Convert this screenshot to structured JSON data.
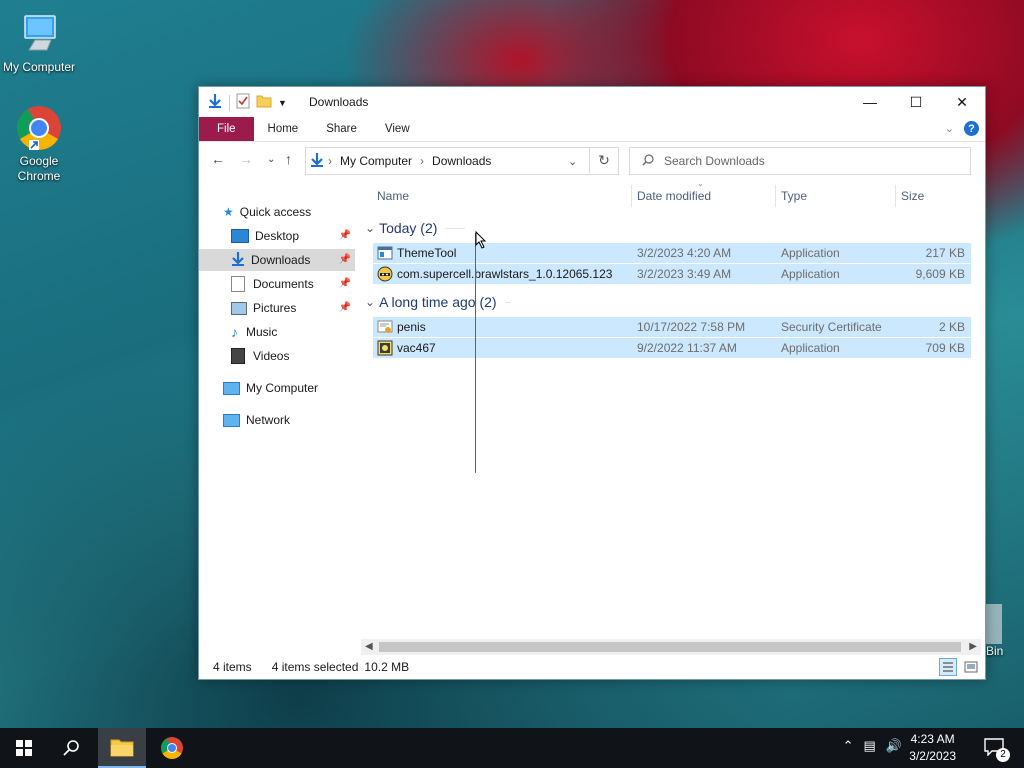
{
  "desktop": {
    "icons": [
      {
        "label": "My Computer"
      },
      {
        "label": "Google Chrome"
      },
      {
        "label": "Bin"
      }
    ]
  },
  "window": {
    "title": "Downloads",
    "ribbon_tabs": [
      "File",
      "Home",
      "Share",
      "View"
    ],
    "help_glyph": "?",
    "breadcrumb": [
      "My Computer",
      "Downloads"
    ],
    "search_placeholder": "Search Downloads"
  },
  "navpane": {
    "quick_access": "Quick access",
    "items": [
      {
        "label": "Desktop",
        "pinned": true
      },
      {
        "label": "Downloads",
        "pinned": true,
        "selected": true
      },
      {
        "label": "Documents",
        "pinned": true
      },
      {
        "label": "Pictures",
        "pinned": true
      },
      {
        "label": "Music",
        "pinned": false
      },
      {
        "label": "Videos",
        "pinned": false
      }
    ],
    "my_computer": "My Computer",
    "network": "Network"
  },
  "columns": [
    "Name",
    "Date modified",
    "Type",
    "Size"
  ],
  "groups": [
    {
      "label": "Today (2)",
      "files": [
        {
          "name": "ThemeTool",
          "date": "3/2/2023 4:20 AM",
          "type": "Application",
          "size": "217 KB",
          "icon": "app-window-icon"
        },
        {
          "name": "com.supercell.brawlstars_1.0.12065.123",
          "date": "3/2/2023 3:49 AM",
          "type": "Application",
          "size": "9,609 KB",
          "icon": "brawl-app-icon"
        }
      ]
    },
    {
      "label": "A long time ago (2)",
      "files": [
        {
          "name": "penis",
          "date": "10/17/2022 7:58 PM",
          "type": "Security Certificate",
          "size": "2 KB",
          "icon": "certificate-icon"
        },
        {
          "name": "vac467",
          "date": "9/2/2022 11:37 AM",
          "type": "Application",
          "size": "709 KB",
          "icon": "app-icon"
        }
      ]
    }
  ],
  "status": {
    "items": "4 items",
    "selected": "4 items selected",
    "size": "10.2 MB"
  },
  "taskbar": {
    "time": "4:23 AM",
    "date": "3/2/2023",
    "notifications": "2"
  },
  "colors": {
    "file_tab": "#9b1b4d",
    "selection": "#cce8ff",
    "accent": "#1e6fcf"
  }
}
